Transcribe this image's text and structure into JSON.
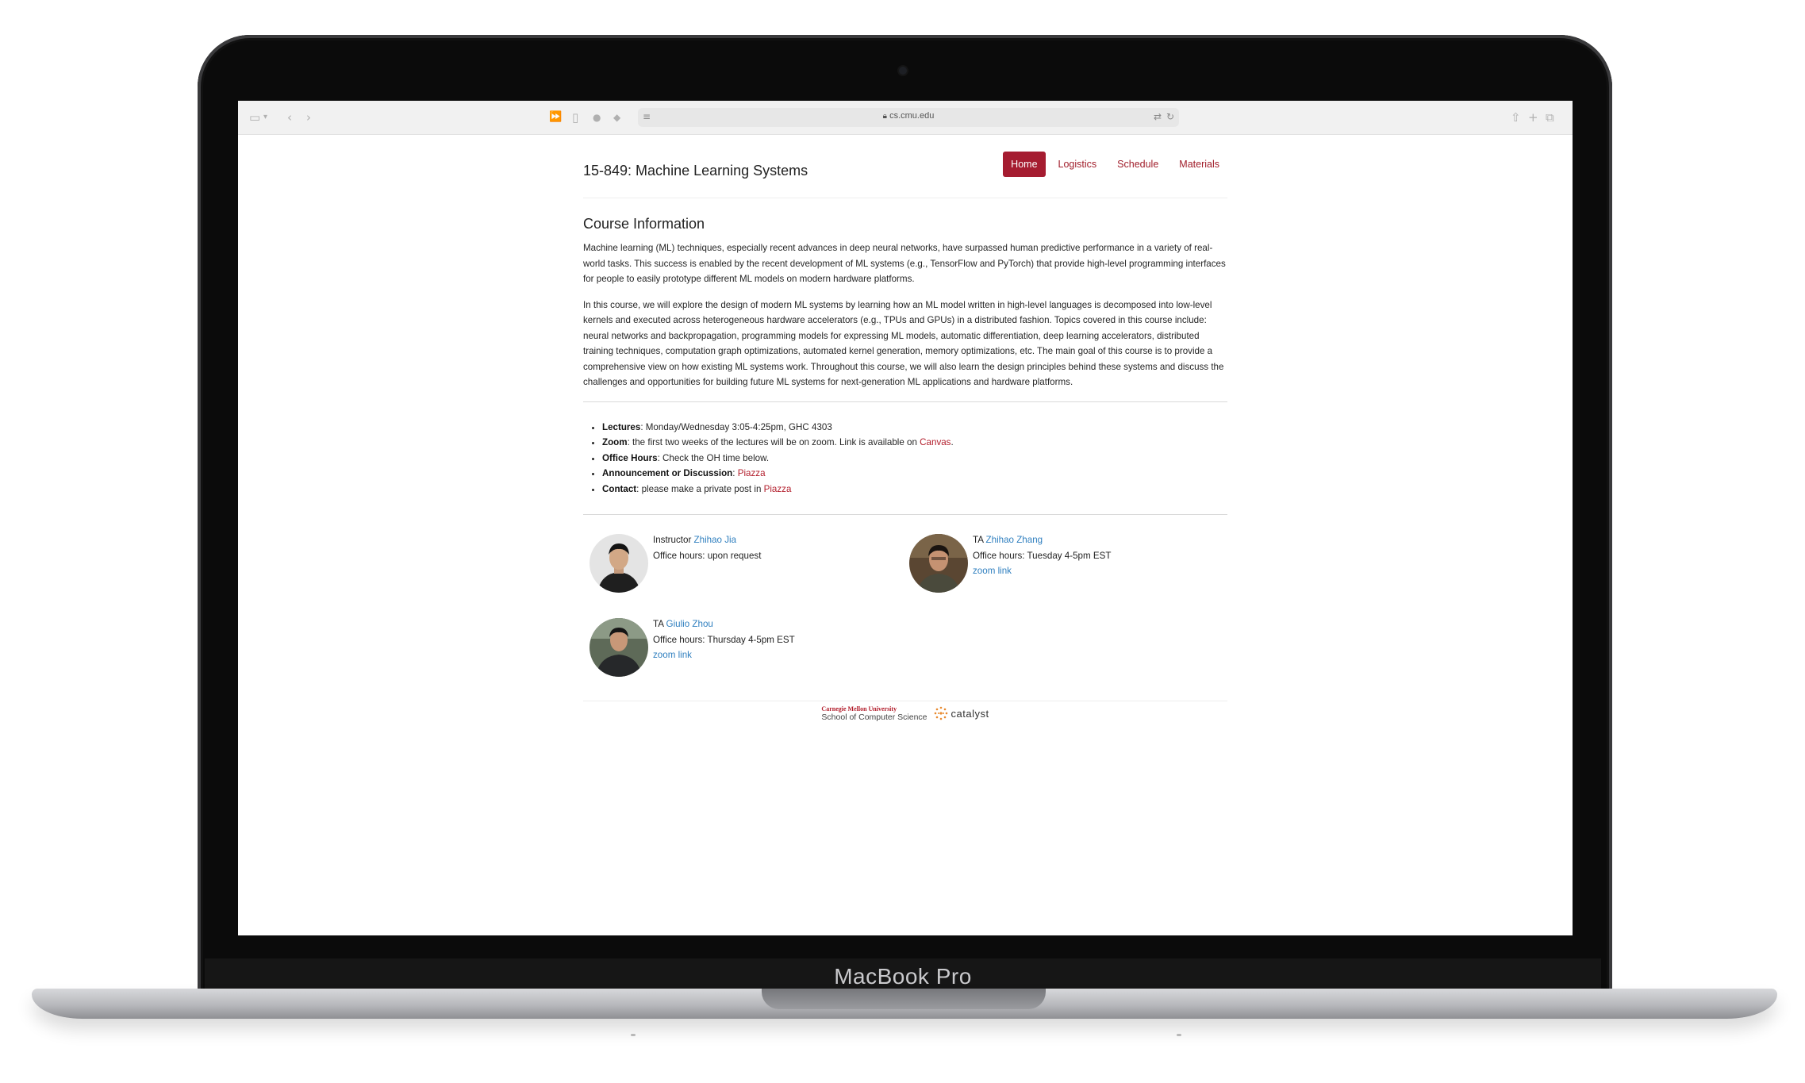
{
  "device": {
    "model_name": "MacBook Pro"
  },
  "browser": {
    "url": "cs.cmu.edu"
  },
  "site": {
    "title": "15-849: Machine Learning Systems",
    "nav": [
      {
        "label": "Home",
        "active": true
      },
      {
        "label": "Logistics",
        "active": false
      },
      {
        "label": "Schedule",
        "active": false
      },
      {
        "label": "Materials",
        "active": false
      }
    ],
    "accent_color": "#a51c30",
    "link_color": "#2f7fbf"
  },
  "course_info": {
    "heading": "Course Information",
    "paragraph_1": "Machine learning (ML) techniques, especially recent advances in deep neural networks, have surpassed human predictive performance in a variety of real-world tasks. This success is enabled by the recent development of ML systems (e.g., TensorFlow and PyTorch) that provide high-level programming interfaces for people to easily prototype different ML models on modern hardware platforms.",
    "paragraph_2": "In this course, we will explore the design of modern ML systems by learning how an ML model written in high-level languages is decomposed into low-level kernels and executed across heterogeneous hardware accelerators (e.g., TPUs and GPUs) in a distributed fashion. Topics covered in this course include: neural networks and backpropagation, programming models for expressing ML models, automatic differentiation, deep learning accelerators, distributed training techniques, computation graph optimizations, automated kernel generation, memory optimizations, etc. The main goal of this course is to provide a comprehensive view on how existing ML systems work. Throughout this course, we will also learn the design principles behind these systems and discuss the challenges and opportunities for building future ML systems for next-generation ML applications and hardware platforms."
  },
  "logistics": {
    "lectures_label": "Lectures",
    "lectures_value": ": Monday/Wednesday 3:05-4:25pm, GHC 4303",
    "zoom_label": "Zoom",
    "zoom_value": ": the first two weeks of the lectures will be on zoom. Link is available on ",
    "zoom_link": "Canvas",
    "zoom_suffix": ".",
    "office_hours_label": "Office Hours",
    "office_hours_value": ": Check the OH time below.",
    "announcement_label": "Announcement or Discussion",
    "announcement_sep": ": ",
    "announcement_link": "Piazza",
    "contact_label": "Contact",
    "contact_value": ": please make a private post in ",
    "contact_link": "Piazza"
  },
  "people": [
    {
      "role": "Instructor ",
      "name": "Zhihao Jia",
      "office_hours": "Office hours: upon request",
      "zoom": ""
    },
    {
      "role": "TA ",
      "name": "Zhihao Zhang",
      "office_hours": "Office hours: Tuesday 4-5pm EST",
      "zoom": "zoom link"
    },
    {
      "role": "TA ",
      "name": "Giulio Zhou",
      "office_hours": "Office hours: Thursday 4-5pm EST",
      "zoom": "zoom link"
    }
  ],
  "footer": {
    "cmu_line1": "Carnegie Mellon University",
    "cmu_line2": "School of Computer Science",
    "catalyst": "catalyst"
  }
}
